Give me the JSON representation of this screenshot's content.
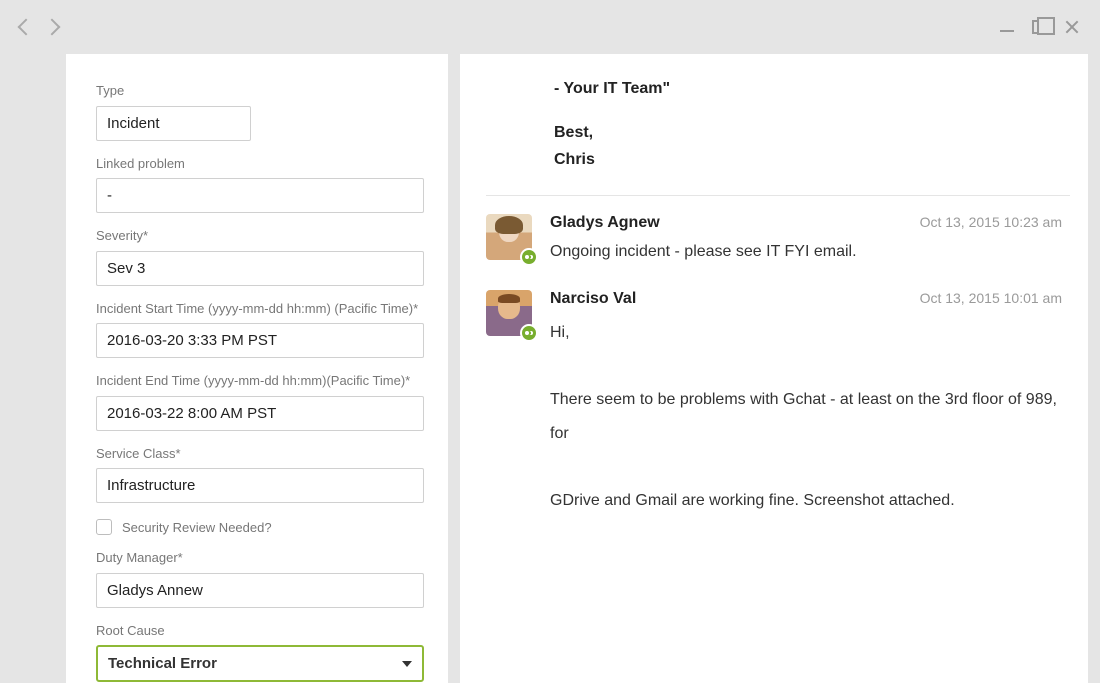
{
  "form": {
    "type_label": "Type",
    "type_value": "Incident",
    "linked_problem_label": "Linked problem",
    "linked_problem_value": "-",
    "severity_label": "Severity*",
    "severity_value": "Sev 3",
    "start_label": "Incident Start Time (yyyy-mm-dd hh:mm) (Pacific Time)*",
    "start_value": "2016-03-20 3:33 PM PST",
    "end_label": "Incident End Time (yyyy-mm-dd hh:mm)(Pacific Time)*",
    "end_value": "2016-03-22 8:00 AM PST",
    "service_class_label": "Service Class*",
    "service_class_value": "Infrastructure",
    "security_review_label": "Security Review Needed?",
    "security_review_checked": false,
    "duty_manager_label": "Duty Manager*",
    "duty_manager_value": "Gladys Annew",
    "root_cause_label": "Root Cause",
    "root_cause_value": "Technical Error"
  },
  "thread": {
    "prev": {
      "line1": "- Your IT Team\"",
      "line2": "Best,",
      "line3": "Chris"
    },
    "comments": [
      {
        "author": "Gladys Agnew",
        "timestamp": "Oct 13, 2015 10:23 am",
        "body": "Ongoing incident - please see IT FYI email."
      },
      {
        "author": "Narciso Val",
        "timestamp": "Oct 13, 2015 10:01 am",
        "body": "Hi,\n\nThere seem to be problems with Gchat - at least on the 3rd floor of 989, for\n\nGDrive and Gmail are working fine. Screenshot attached."
      }
    ]
  }
}
